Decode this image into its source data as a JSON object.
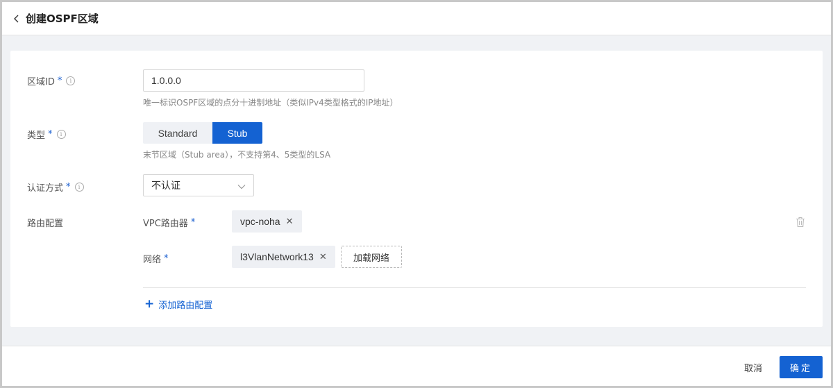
{
  "header": {
    "title": "创建OSPF区域",
    "back_icon": "chevron-left-icon"
  },
  "form": {
    "area_id": {
      "label": "区域ID",
      "required_mark": "*",
      "value": "1.0.0.0",
      "hint": "唯一标识OSPF区域的点分十进制地址（类似IPv4类型格式的IP地址）"
    },
    "type": {
      "label": "类型",
      "required_mark": "*",
      "options": [
        "Standard",
        "Stub"
      ],
      "selected": "Stub",
      "hint": "末节区域（Stub area），不支持第4、5类型的LSA"
    },
    "auth": {
      "label": "认证方式",
      "required_mark": "*",
      "value": "不认证"
    },
    "route": {
      "label": "路由配置",
      "vpc_router_label": "VPC路由器",
      "vpc_router_required": "*",
      "vpc_router_tag": "vpc-noha",
      "network_label": "网络",
      "network_required": "*",
      "network_tag": "l3VlanNetwork13",
      "load_network_label": "加载网络",
      "add_route_label": "添加路由配置",
      "close_glyph": "✕",
      "plus_glyph": "+"
    }
  },
  "footer": {
    "cancel_label": "取消",
    "confirm_label": "确定"
  },
  "colors": {
    "primary": "#1462d2",
    "required": "#1a5fd0",
    "background": "#f0f2f5"
  }
}
